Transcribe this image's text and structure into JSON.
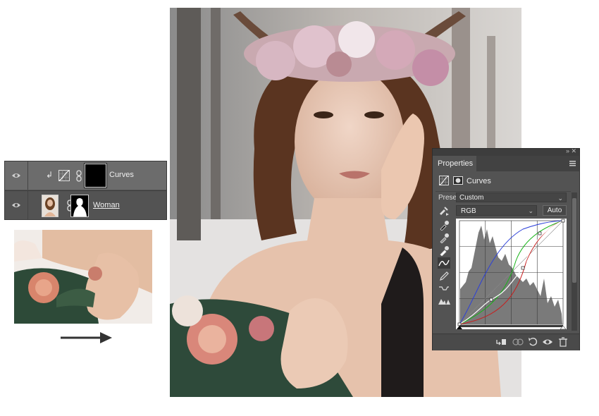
{
  "layers": {
    "rows": [
      {
        "name": "Curves"
      },
      {
        "name": "Woman "
      }
    ]
  },
  "properties": {
    "tab": "Properties",
    "header_title": "Curves",
    "preset_label": "Preset:",
    "preset_value": "Custom",
    "channel_value": "RGB",
    "auto_label": "Auto"
  },
  "colors": {
    "panel_bg": "#535353",
    "selected_row": "#6c6c6c",
    "rgb_curve": "#ffffff",
    "red_curve": "#c81e1e",
    "green_curve": "#19b419",
    "blue_curve": "#2b3fd9"
  },
  "icons": [
    "eye-icon",
    "clip-arrow-icon",
    "curves-adjustment-icon",
    "chain-link-icon",
    "panel-menu-icon",
    "sample-image-icon",
    "eyedropper-black-icon",
    "eyedropper-gray-icon",
    "eyedropper-white-icon",
    "curve-edit-icon",
    "pencil-icon",
    "smooth-icon",
    "clipping-warning-icon",
    "clip-to-layer-icon",
    "view-previous-icon",
    "reset-icon",
    "visibility-icon",
    "trash-icon",
    "arrow-right-icon"
  ]
}
